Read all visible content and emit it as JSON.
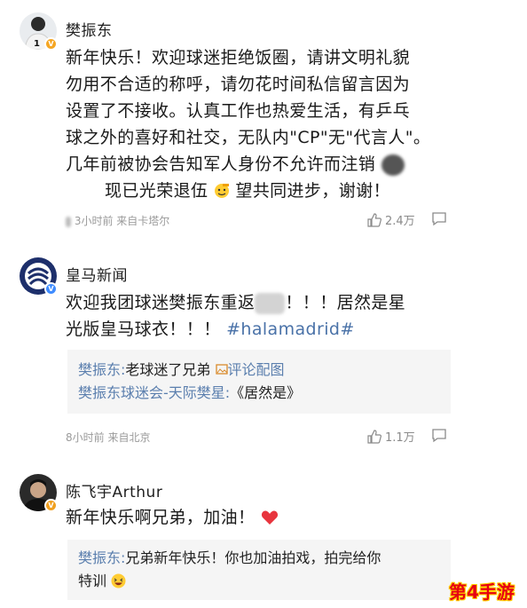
{
  "posts": [
    {
      "author": "樊振东",
      "content_line1": "新年快乐！欢迎球迷拒绝饭圈，请讲文明礼貌",
      "content_line2": "勿用不合适的称呼，请勿花时间私信留言因为",
      "content_line3": "设置了不接收。认真工作也热爱生活，有乒乓",
      "content_line4": "球之外的喜好和社交，无队内\"CP\"无\"代言人\"。",
      "content_line5": "几年前被协会告知军人身份不允许而注销",
      "content_line6a": "现已光荣退伍",
      "content_line6b": "望共同进步，谢谢！",
      "meta": "3小时前 来自卡塔尔",
      "likes": "2.4万"
    },
    {
      "author": "皇马新闻",
      "content_line1a": "欢迎我团球迷樊振东重返",
      "content_line1b": "！！！居然是星",
      "content_line2a": "光版皇马球衣！！！",
      "content_line2b": "#halamadrid#",
      "replies": [
        {
          "who": "樊振东:",
          "text": "老球迷了兄弟",
          "link": "评论配图"
        },
        {
          "who": "樊振东球迷会-天际樊星:",
          "text": "《居然是》"
        }
      ],
      "meta": "8小时前 来自北京",
      "likes": "1.1万"
    },
    {
      "author": "陈飞宇Arthur",
      "content": "新年快乐啊兄弟，加油！",
      "replies": [
        {
          "who": "樊振东:",
          "text_line1": "兄弟新年快乐！你也加油拍戏，拍完给你",
          "text_line2": "特训"
        }
      ]
    }
  ],
  "watermark": "第4手游",
  "colors": {
    "link": "#5b7fae",
    "meta": "#9a9a9a",
    "badge": "#f5a623",
    "heart": "#e8353e"
  },
  "icons": [
    "thumbs-up-icon",
    "comment-icon",
    "verified-badge-icon",
    "heart-icon",
    "salute-emoji-icon",
    "laugh-emoji-icon"
  ]
}
